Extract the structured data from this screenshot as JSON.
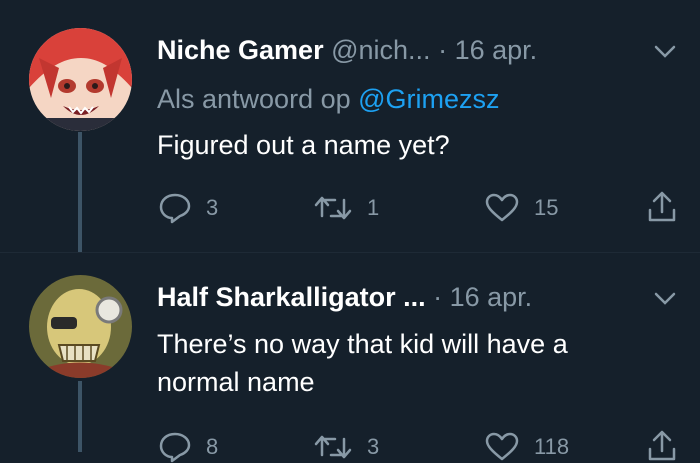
{
  "tweets": [
    {
      "display_name": "Niche Gamer",
      "handle": "@nich...",
      "separator": "·",
      "date": "16 apr.",
      "reply_prefix": "Als antwoord op",
      "reply_mention": "@Grimezsz",
      "text": "Figured out a name yet?",
      "actions": {
        "replies": "3",
        "retweets": "1",
        "likes": "15"
      },
      "icons": [
        "reply-icon",
        "retweet-icon",
        "like-icon",
        "share-icon",
        "chevron-down-icon"
      ]
    },
    {
      "display_name": "Half Sharkalligator ...",
      "separator": "·",
      "date": "16 apr.",
      "text": "There’s no way that kid will have a normal name",
      "actions": {
        "replies": "8",
        "retweets": "3",
        "likes": "118"
      },
      "icons": [
        "reply-icon",
        "retweet-icon",
        "like-icon",
        "share-icon",
        "chevron-down-icon"
      ]
    }
  ],
  "colors": {
    "background": "#15202b",
    "text": "#ffffff",
    "muted": "#8899a6",
    "link": "#1da1f2",
    "thread": "#3d5466"
  }
}
